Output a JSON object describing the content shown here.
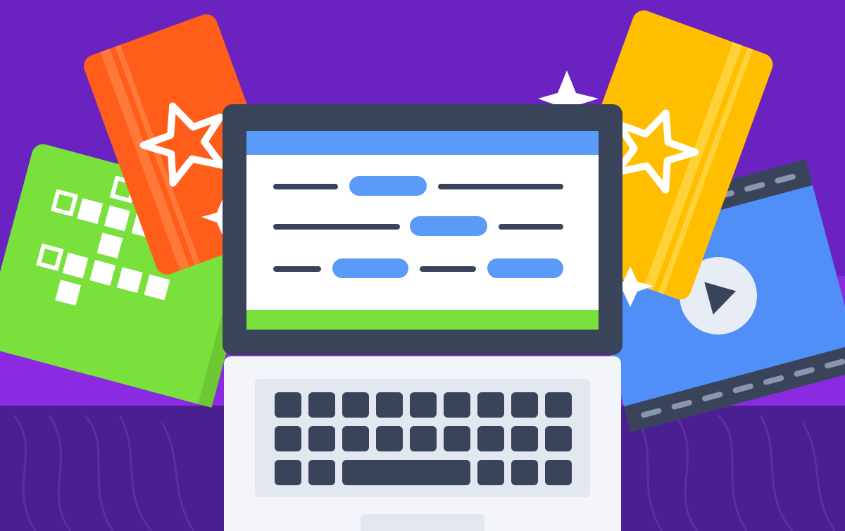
{
  "scene": {
    "description_visible_text": "",
    "colors": {
      "background_top": "#6a22c0",
      "background_band": "#8a2be2",
      "table": "#4a1f8f",
      "table_grain": "#5e2da8",
      "card_green": "#7ae03c",
      "card_orange": "#ff5e1a",
      "card_yellow": "#ffbf00",
      "card_blue": "#4f8ff7",
      "laptop_frame": "#39435a",
      "screen_bar_top": "#5a9af8",
      "screen_bar_bottom": "#7ae03c",
      "screen_bg": "#ffffff",
      "pill": "#5a9af8",
      "line": "#39435a",
      "keyboard_body": "#f3f5fa",
      "keyboard_panel": "#e3e7f0",
      "key": "#39435a",
      "star": "#ffffff"
    },
    "icons": {
      "crossword_card": "crossword-icon",
      "flashcard_orange": "star-icon",
      "flashcard_yellow": "star-icon",
      "video_card": "play-icon",
      "sparkle": "sparkle-icon"
    }
  }
}
